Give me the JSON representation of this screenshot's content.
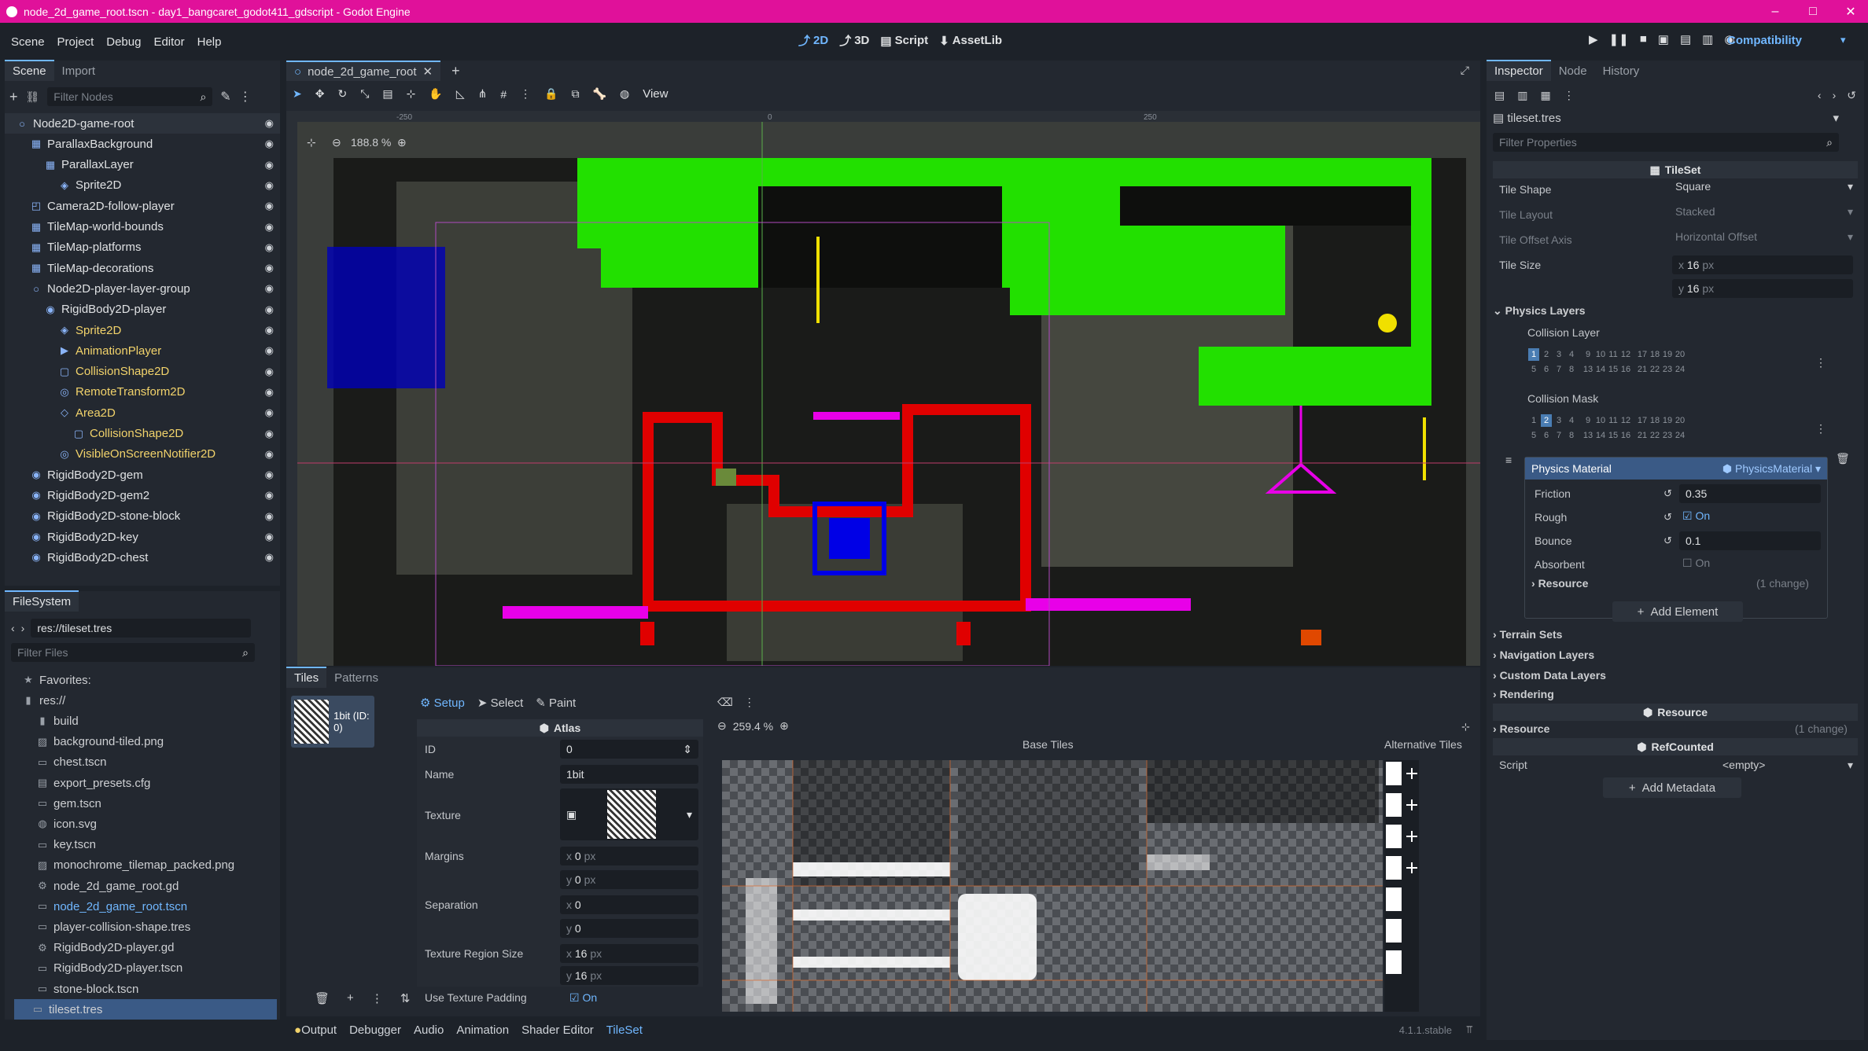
{
  "window": {
    "title": "node_2d_game_root.tscn - day1_bangcaret_godot411_gdscript - Godot Engine",
    "controls": [
      "–",
      "□",
      "✕"
    ]
  },
  "menu": {
    "items": [
      "Scene",
      "Project",
      "Debug",
      "Editor",
      "Help"
    ]
  },
  "modes": [
    {
      "label": "2D",
      "icon": "2d-icon",
      "active": true
    },
    {
      "label": "3D",
      "icon": "3d-icon",
      "active": false
    },
    {
      "label": "Script",
      "icon": "script-icon",
      "active": false
    },
    {
      "label": "AssetLib",
      "icon": "assetlib-icon",
      "active": false
    }
  ],
  "renderer": "Compatibility",
  "scene_dock": {
    "tabs": [
      "Scene",
      "Import"
    ],
    "filter_placeholder": "Filter Nodes",
    "nodes": [
      {
        "name": "Node2D-game-root",
        "depth": 0,
        "color": "#dfe1e3",
        "icon": "node2d-icon"
      },
      {
        "name": "ParallaxBackground",
        "depth": 1,
        "color": "#dfe1e3",
        "icon": "parallax-icon"
      },
      {
        "name": "ParallaxLayer",
        "depth": 2,
        "color": "#dfe1e3",
        "icon": "parallax-layer-icon"
      },
      {
        "name": "Sprite2D",
        "depth": 3,
        "color": "#dfe1e3",
        "icon": "sprite-icon"
      },
      {
        "name": "Camera2D-follow-player",
        "depth": 1,
        "color": "#dfe1e3",
        "icon": "camera-icon"
      },
      {
        "name": "TileMap-world-bounds",
        "depth": 1,
        "color": "#dfe1e3",
        "icon": "tilemap-icon"
      },
      {
        "name": "TileMap-platforms",
        "depth": 1,
        "color": "#dfe1e3",
        "icon": "tilemap-icon"
      },
      {
        "name": "TileMap-decorations",
        "depth": 1,
        "color": "#dfe1e3",
        "icon": "tilemap-icon"
      },
      {
        "name": "Node2D-player-layer-group",
        "depth": 1,
        "color": "#dfe1e3",
        "icon": "node2d-icon"
      },
      {
        "name": "RigidBody2D-player",
        "depth": 2,
        "color": "#dfe1e3",
        "icon": "rigidbody-icon"
      },
      {
        "name": "Sprite2D",
        "depth": 3,
        "color": "#f2d36b",
        "icon": "sprite-icon"
      },
      {
        "name": "AnimationPlayer",
        "depth": 3,
        "color": "#f2d36b",
        "icon": "animation-icon"
      },
      {
        "name": "CollisionShape2D",
        "depth": 3,
        "color": "#f2d36b",
        "icon": "collision-icon"
      },
      {
        "name": "RemoteTransform2D",
        "depth": 3,
        "color": "#f2d36b",
        "icon": "remote-icon"
      },
      {
        "name": "Area2D",
        "depth": 3,
        "color": "#f2d36b",
        "icon": "area-icon"
      },
      {
        "name": "CollisionShape2D",
        "depth": 4,
        "color": "#f2d36b",
        "icon": "collision-icon"
      },
      {
        "name": "VisibleOnScreenNotifier2D",
        "depth": 3,
        "color": "#f2d36b",
        "icon": "notifier-icon"
      },
      {
        "name": "RigidBody2D-gem",
        "depth": 1,
        "color": "#dfe1e3",
        "icon": "rigidbody-icon"
      },
      {
        "name": "RigidBody2D-gem2",
        "depth": 1,
        "color": "#dfe1e3",
        "icon": "rigidbody-icon"
      },
      {
        "name": "RigidBody2D-stone-block",
        "depth": 1,
        "color": "#dfe1e3",
        "icon": "rigidbody-icon"
      },
      {
        "name": "RigidBody2D-key",
        "depth": 1,
        "color": "#dfe1e3",
        "icon": "rigidbody-icon"
      },
      {
        "name": "RigidBody2D-chest",
        "depth": 1,
        "color": "#dfe1e3",
        "icon": "rigidbody-icon"
      }
    ]
  },
  "filesystem": {
    "tab": "FileSystem",
    "path": "res://tileset.tres",
    "filter_placeholder": "Filter Files",
    "items": [
      {
        "name": "Favorites:",
        "depth": 0,
        "icon": "star-icon"
      },
      {
        "name": "res://",
        "depth": 0,
        "icon": "folder-icon"
      },
      {
        "name": "build",
        "depth": 1,
        "icon": "folder-icon"
      },
      {
        "name": "background-tiled.png",
        "depth": 1,
        "icon": "image-icon"
      },
      {
        "name": "chest.tscn",
        "depth": 1,
        "icon": "scene-icon"
      },
      {
        "name": "export_presets.cfg",
        "depth": 1,
        "icon": "file-icon"
      },
      {
        "name": "gem.tscn",
        "depth": 1,
        "icon": "scene-icon"
      },
      {
        "name": "icon.svg",
        "depth": 1,
        "icon": "svg-icon"
      },
      {
        "name": "key.tscn",
        "depth": 1,
        "icon": "scene-icon"
      },
      {
        "name": "monochrome_tilemap_packed.png",
        "depth": 1,
        "icon": "image-icon"
      },
      {
        "name": "node_2d_game_root.gd",
        "depth": 1,
        "icon": "gear-icon"
      },
      {
        "name": "node_2d_game_root.tscn",
        "depth": 1,
        "icon": "scene-icon",
        "color": "#70b7ff"
      },
      {
        "name": "player-collision-shape.tres",
        "depth": 1,
        "icon": "resource-icon"
      },
      {
        "name": "RigidBody2D-player.gd",
        "depth": 1,
        "icon": "gear-icon"
      },
      {
        "name": "RigidBody2D-player.tscn",
        "depth": 1,
        "icon": "scene-icon"
      },
      {
        "name": "stone-block.tscn",
        "depth": 1,
        "icon": "scene-icon"
      },
      {
        "name": "tileset.tres",
        "depth": 1,
        "icon": "resource-icon",
        "selected": true
      }
    ]
  },
  "editor": {
    "scene_tab": "node_2d_game_root",
    "view_label": "View",
    "zoom": "188.8 %",
    "ruler": [
      "-250",
      "0",
      "250"
    ]
  },
  "tiles_panel": {
    "tabs": [
      "Tiles",
      "Patterns"
    ],
    "source": "1bit (ID: 0)",
    "tools": [
      "Setup",
      "Select",
      "Paint"
    ],
    "zoom": "259.4 %",
    "base_label": "Base Tiles",
    "alt_label": "Alternative Tiles",
    "atlas": {
      "header": "Atlas",
      "id_label": "ID",
      "id": "0",
      "name_label": "Name",
      "name": "1bit",
      "texture_label": "Texture",
      "margins_label": "Margins",
      "margin_x": "0",
      "margin_y": "0",
      "separation_label": "Separation",
      "sep_x": "0",
      "sep_y": "0",
      "region_label": "Texture Region Size",
      "region_x": "16",
      "region_y": "16",
      "padding_label": "Use Texture Padding",
      "padding": "On",
      "px": "px",
      "x": "x",
      "y": "y"
    }
  },
  "bottom_bar": {
    "tabs": [
      "Output",
      "Debugger",
      "Audio",
      "Animation",
      "Shader Editor",
      "TileSet"
    ],
    "version": "4.1.1.stable"
  },
  "inspector": {
    "tabs": [
      "Inspector",
      "Node",
      "History"
    ],
    "resource": "tileset.tres",
    "filter_placeholder": "Filter Properties",
    "section": "TileSet",
    "tile_shape_label": "Tile Shape",
    "tile_shape": "Square",
    "tile_layout_label": "Tile Layout",
    "tile_layout": "Stacked",
    "tile_offset_label": "Tile Offset Axis",
    "tile_offset": "Horizontal Offset",
    "tile_size_label": "Tile Size",
    "tile_size_x": "16",
    "tile_size_y": "16",
    "px": "px",
    "physics_layers": "Physics Layers",
    "collision_layer": "Collision Layer",
    "collision_mask": "Collision Mask",
    "layer_numbers": [
      "1",
      "2",
      "3",
      "4",
      "9",
      "10",
      "11",
      "12",
      "17",
      "18",
      "19",
      "20",
      "5",
      "6",
      "7",
      "8",
      "13",
      "14",
      "15",
      "16",
      "21",
      "22",
      "23",
      "24"
    ],
    "physics_material_label": "Physics Material",
    "physics_material": "PhysicsMaterial",
    "friction_label": "Friction",
    "friction": "0.35",
    "rough_label": "Rough",
    "rough": "On",
    "bounce_label": "Bounce",
    "bounce": "0.1",
    "absorbent_label": "Absorbent",
    "absorbent": "On",
    "resource_label": "Resource",
    "resource_changes": "(1 change)",
    "add_element": "Add Element",
    "terrain_sets": "Terrain Sets",
    "navigation_layers": "Navigation Layers",
    "custom_data_layers": "Custom Data Layers",
    "rendering": "Rendering",
    "resource_section": "Resource",
    "resource_label2": "Resource",
    "resource_changes2": "(1 change)",
    "refcounted": "RefCounted",
    "script_label": "Script",
    "script_value": "<empty>",
    "add_metadata": "Add Metadata"
  },
  "colors": {
    "accent": "#70b7ff",
    "title_bar": "#e0119a",
    "green": "#22e000",
    "magenta": "#e800e8",
    "red": "#e00000",
    "blue": "#0000e6"
  }
}
